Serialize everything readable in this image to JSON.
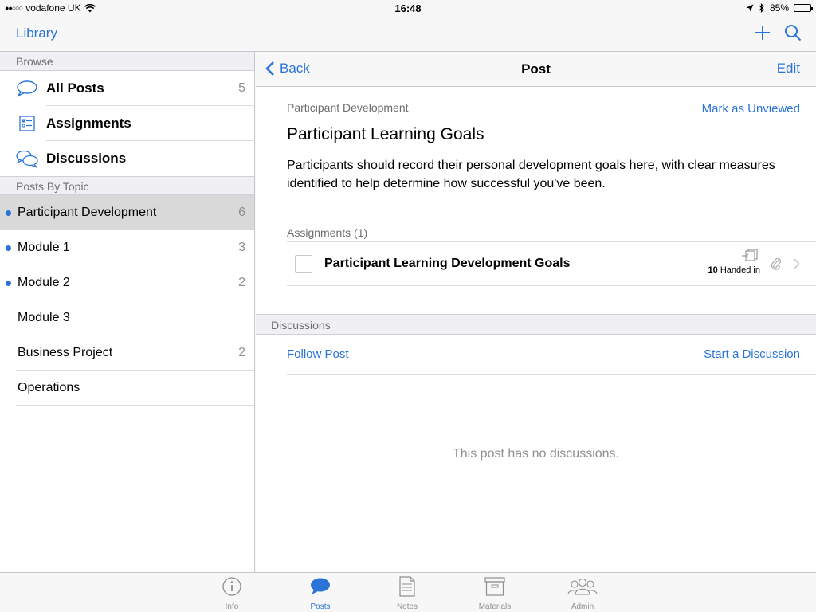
{
  "status_bar": {
    "carrier": "vodafone UK",
    "time": "16:48",
    "battery": "85%",
    "battery_level": 0.85
  },
  "top_bar": {
    "library_label": "Library",
    "add_icon": "plus-icon",
    "search_icon": "search-icon"
  },
  "sidebar": {
    "browse_header": "Browse",
    "browse_items": [
      {
        "label": "All Posts",
        "count": "5",
        "icon": "speech-bubble-icon"
      },
      {
        "label": "Assignments",
        "icon": "checklist-icon"
      },
      {
        "label": "Discussions",
        "icon": "discussion-bubbles-icon"
      }
    ],
    "topics_header": "Posts By Topic",
    "topics": [
      {
        "label": "Participant Development",
        "count": "6",
        "unread": true,
        "selected": true
      },
      {
        "label": "Module 1",
        "count": "3",
        "unread": true
      },
      {
        "label": "Module 2",
        "count": "2",
        "unread": true
      },
      {
        "label": "Module 3",
        "count": "",
        "unread": false
      },
      {
        "label": "Business Project",
        "count": "2",
        "unread": false
      },
      {
        "label": "Operations",
        "count": "",
        "unread": false
      }
    ]
  },
  "detail_bar": {
    "back_label": "Back",
    "title": "Post",
    "edit_label": "Edit"
  },
  "post": {
    "topic": "Participant Development",
    "mark_unviewed": "Mark as Unviewed",
    "title": "Participant Learning Goals",
    "body": "Participants should record their personal development goals here, with clear measures identified to help determine how successful you've been.",
    "assignments_header": "Assignments (1)",
    "assignment": {
      "title": "Participant Learning Development Goals",
      "handed_in_count": "10",
      "handed_in_label": "Handed in"
    }
  },
  "discussions": {
    "header": "Discussions",
    "follow_label": "Follow Post",
    "start_label": "Start a Discussion",
    "empty_text": "This post has no discussions."
  },
  "tab_bar": {
    "tabs": [
      {
        "label": "Info",
        "icon": "info-icon"
      },
      {
        "label": "Posts",
        "icon": "posts-bubble-icon",
        "active": true
      },
      {
        "label": "Notes",
        "icon": "notes-icon"
      },
      {
        "label": "Materials",
        "icon": "materials-box-icon"
      },
      {
        "label": "Admin",
        "icon": "admin-people-icon"
      }
    ]
  },
  "colors": {
    "accent": "#2a74d6",
    "selected_row": "#d9d9d9",
    "section_bg": "#efeff4"
  }
}
